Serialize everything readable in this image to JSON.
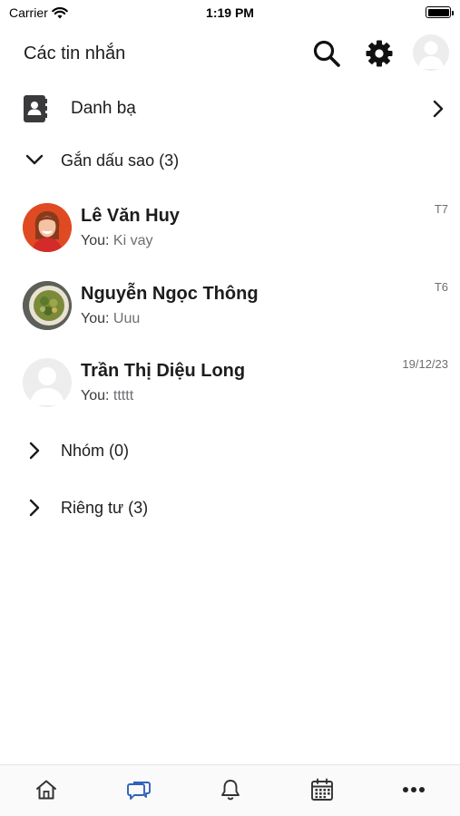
{
  "status_bar": {
    "carrier": "Carrier",
    "time": "1:19 PM",
    "icons": [
      "wifi-icon",
      "battery-icon"
    ]
  },
  "header": {
    "title": "Các tin nhắn",
    "icons": [
      "search-icon",
      "gear-icon",
      "avatar"
    ]
  },
  "contacts": {
    "label": "Danh bạ",
    "icon": "contact-book-icon"
  },
  "starred": {
    "label": "Gắn dấu sao (3)",
    "expanded": true
  },
  "chats": [
    {
      "name": "Lê Văn Huy",
      "you_prefix": "You:",
      "message": "Ki vay",
      "time": "T7",
      "avatar": "photo-woman"
    },
    {
      "name": "Nguyễn Ngọc Thông",
      "you_prefix": "You:",
      "message": "Uuu",
      "time": "T6",
      "avatar": "photo-food"
    },
    {
      "name": "Trần Thị Diệu Long",
      "you_prefix": "You:",
      "message": "ttttt",
      "time": "19/12/23",
      "avatar": "default-avatar"
    }
  ],
  "groups": {
    "label": "Nhóm (0)",
    "expanded": false
  },
  "private": {
    "label": "Riêng tư (3)",
    "expanded": false
  },
  "tab_bar": {
    "tabs": [
      "home-icon",
      "chat-icon",
      "bell-icon",
      "calendar-icon",
      "more-icon"
    ],
    "active": "chat-icon",
    "accent_color": "#2f63b8"
  }
}
